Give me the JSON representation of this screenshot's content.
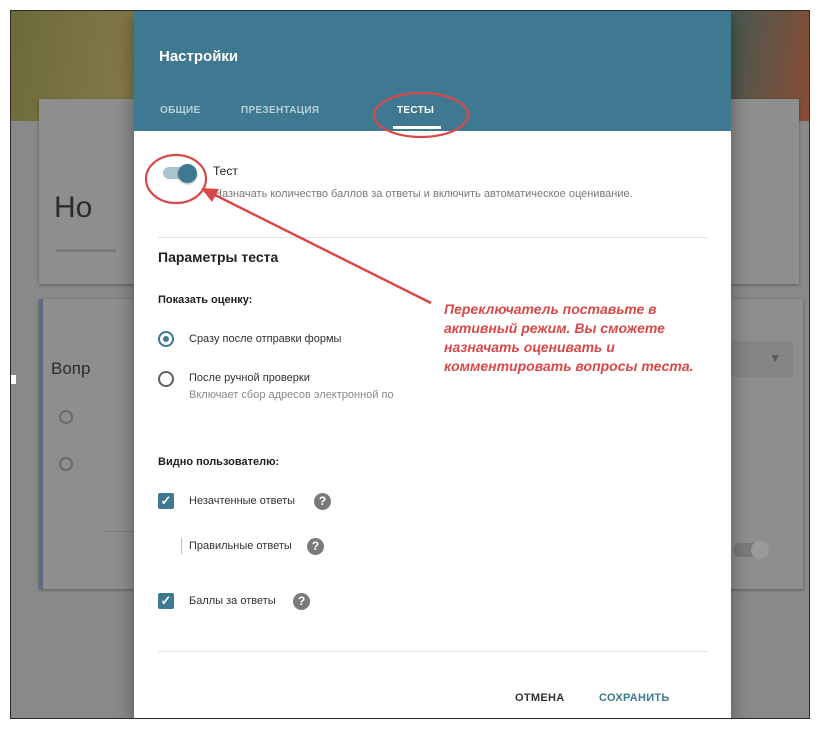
{
  "background": {
    "form_title": "Но",
    "question_title": "Вопр"
  },
  "dialog": {
    "title": "Настройки",
    "tabs": [
      {
        "label": "ОБЩИЕ",
        "active": false
      },
      {
        "label": "ПРЕЗЕНТАЦИЯ",
        "active": false
      },
      {
        "label": "ТЕСТЫ",
        "active": true
      }
    ],
    "quiz_toggle": {
      "label": "Тест",
      "description": "Назначать количество баллов за ответы и включить автоматическое оценивание.",
      "enabled": true
    },
    "section_title": "Параметры теста",
    "release_grade": {
      "label": "Показать оценку:",
      "options": [
        {
          "label": "Сразу после отправки формы",
          "selected": true
        },
        {
          "label": "После ручной проверки",
          "selected": false,
          "description": "Включает сбор адресов электронной по"
        }
      ]
    },
    "respondent_view": {
      "label": "Видно пользователю:",
      "items": [
        {
          "label": "Незачтенные ответы",
          "checked": true
        },
        {
          "label": "Правильные ответы",
          "checked": false
        },
        {
          "label": "Баллы за ответы",
          "checked": true
        }
      ]
    },
    "buttons": {
      "cancel": "ОТМЕНА",
      "save": "СОХРАНИТЬ"
    }
  },
  "annotation": {
    "text": "Переключатель поставьте в активный режим. Вы сможете назначать оценивать и комментировать вопросы теста.",
    "color": "#d94848"
  },
  "colors": {
    "header": "#3f7891",
    "accent": "#3f7891",
    "annotation": "#d94848"
  },
  "icons": {
    "help": "help-circle-icon",
    "check": "check-icon"
  }
}
